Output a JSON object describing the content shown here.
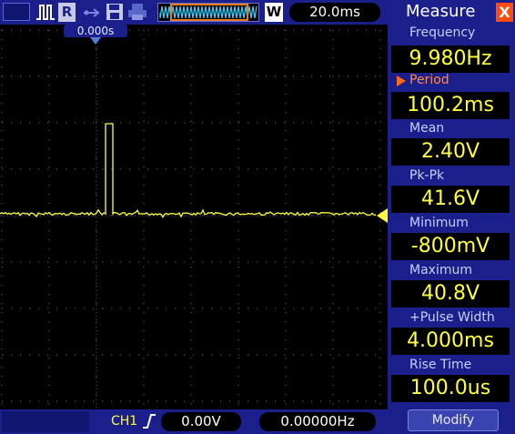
{
  "topbar": {
    "run_state": "R",
    "w_badge": "W",
    "timebase": "20.0ms"
  },
  "screen": {
    "trigger_position": "0.000s",
    "trace_color": "#ffff40"
  },
  "bottombar": {
    "channel": "CH1",
    "trigger_level": "0.00V",
    "trigger_frequency": "0.00000Hz"
  },
  "panel": {
    "title": "Measure",
    "close_label": "X",
    "measurements": [
      {
        "label": "Frequency",
        "value": "9.980Hz",
        "selected": false
      },
      {
        "label": "Period",
        "value": "100.2ms",
        "selected": true
      },
      {
        "label": "Mean",
        "value": "2.40V",
        "selected": false
      },
      {
        "label": "Pk-Pk",
        "value": "41.6V",
        "selected": false
      },
      {
        "label": "Minimum",
        "value": "-800mV",
        "selected": false
      },
      {
        "label": "Maximum",
        "value": "40.8V",
        "selected": false
      },
      {
        "label": "+Pulse Width",
        "value": "4.000ms",
        "selected": false
      },
      {
        "label": "Rise Time",
        "value": "100.0us",
        "selected": false
      }
    ],
    "modify_label": "Modify"
  },
  "colors": {
    "bar_bg": "#1a1f8c",
    "accent_orange": "#ff6a1a",
    "trace_yellow": "#ffff40"
  }
}
